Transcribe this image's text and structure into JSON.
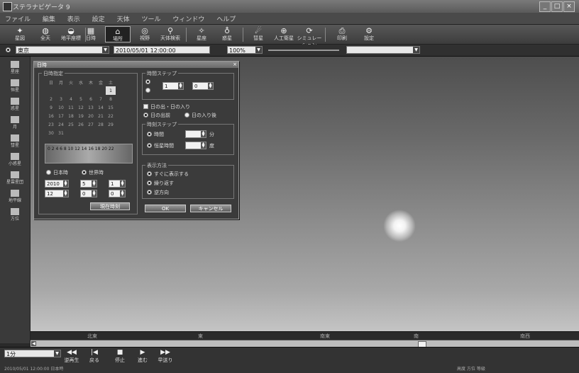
{
  "window": {
    "title": "ステラナビゲータ 9"
  },
  "menu": [
    "ファイル",
    "編集",
    "表示",
    "設定",
    "天体",
    "ツール",
    "ウィンドウ",
    "ヘルプ"
  ],
  "toolbar": [
    {
      "label": "星図"
    },
    {
      "label": "全天"
    },
    {
      "label": "地平座標"
    },
    {
      "label": "日時"
    },
    {
      "label": "場所"
    },
    {
      "label": "視野"
    },
    {
      "label": "天体検索"
    },
    {
      "label": "星座"
    },
    {
      "label": "惑星"
    },
    {
      "label": "彗星"
    },
    {
      "label": "人工衛星"
    },
    {
      "label": "シミュレーション"
    },
    {
      "label": "印刷"
    },
    {
      "label": "設定"
    }
  ],
  "toolbar2": {
    "location": "東京",
    "date": "2010/05/01 12:00:00",
    "zoom": "100%"
  },
  "sidebar": [
    "星座",
    "恒星",
    "惑星",
    "月",
    "彗星",
    "小惑星",
    "星雲星団",
    "地平線",
    "方位"
  ],
  "dialog": {
    "title": "日時",
    "calendar_group": "日時指定",
    "weekdays": [
      "日",
      "月",
      "火",
      "水",
      "木",
      "金",
      "土"
    ],
    "calendar": [
      [
        "",
        "",
        "",
        "",
        "",
        "",
        "1"
      ],
      [
        "2",
        "3",
        "4",
        "5",
        "6",
        "7",
        "8"
      ],
      [
        "9",
        "10",
        "11",
        "12",
        "13",
        "14",
        "15"
      ],
      [
        "16",
        "17",
        "18",
        "19",
        "20",
        "21",
        "22"
      ],
      [
        "23",
        "24",
        "25",
        "26",
        "27",
        "28",
        "29"
      ],
      [
        "30",
        "31",
        "",
        "",
        "",
        "",
        ""
      ]
    ],
    "hours": "0 2 4 6 8 10 12 14 16 18 20 22",
    "radio_local": "日本時",
    "radio_ut": "世界時",
    "year": "2010",
    "month": "5",
    "day": "1",
    "hour": "12",
    "minute": "0",
    "second": "0",
    "now_button": "現在時刻",
    "step_group": "時間ステップ",
    "step_value1": "1",
    "step_value2": "0",
    "sunrise_group": "日の出・日の入り",
    "sunrise": "日の出前",
    "sunset": "日の入り後",
    "time_group": "時刻ステップ",
    "time_label": "時間",
    "time_unit": "分",
    "sid_label": "恒星時間",
    "sid_unit": "度",
    "display_group": "表示方法",
    "display_opt1": "すぐに表示する",
    "display_opt2": "繰り返す",
    "display_opt3": "逆方向",
    "ok_button": "OK",
    "cancel_button": "キャンセル"
  },
  "timestrip": [
    "北東",
    "東",
    "南東",
    "南",
    "南西"
  ],
  "bottom": {
    "mode": "1分",
    "buttons": [
      "逆再生",
      "戻る",
      "停止",
      "進む",
      "早送り"
    ],
    "status_left": "2010/05/01 12:00:00 日本時",
    "status_right": "高度 方位 等級"
  },
  "colors": {
    "sky_top": "#4e4e4e",
    "sky_bottom": "#c4c4c4",
    "sun": "#ffffff"
  }
}
